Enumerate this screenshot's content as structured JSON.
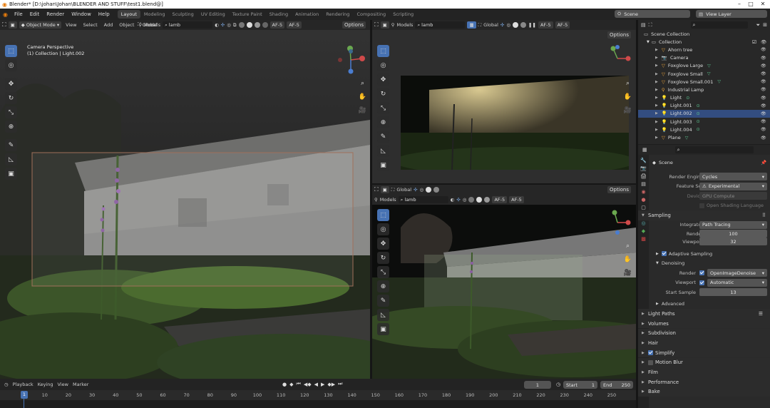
{
  "window": {
    "title": "Blender* [D:\\johan\\Johan\\BLENDER AND STUFF\\test1.blend@]"
  },
  "menu": [
    "File",
    "Edit",
    "Render",
    "Window",
    "Help"
  ],
  "workspaces": [
    "Layout",
    "Modeling",
    "Sculpting",
    "UV Editing",
    "Texture Paint",
    "Shading",
    "Animation",
    "Rendering",
    "Compositing",
    "Scripting"
  ],
  "active_workspace": "Layout",
  "top_right": {
    "scene": "Scene",
    "view_layer": "View Layer"
  },
  "viewport_main": {
    "mode": "Object Mode",
    "menus": [
      "View",
      "Select",
      "Add",
      "Object"
    ],
    "transform": "Global",
    "filter": "Models",
    "search": "lamb",
    "af": "AF-5",
    "options": "Options",
    "overlay_title": "Camera Perspective",
    "overlay_sub": "(1) Collection | Light.002"
  },
  "viewport_tr": {
    "transform": "Global",
    "filter": "Models",
    "search": "lamb",
    "af": "AF-5",
    "options": "Options"
  },
  "viewport_br": {
    "transform": "Global",
    "filter": "Models",
    "search": "lamb",
    "af": "AF-5",
    "options": "Options"
  },
  "outliner": {
    "root": "Scene Collection",
    "collection": "Collection",
    "items": [
      {
        "name": "Ahorn tree",
        "selected": false
      },
      {
        "name": "Camera",
        "selected": false
      },
      {
        "name": "Foxglove Large",
        "selected": false
      },
      {
        "name": "Foxglove Small",
        "selected": false
      },
      {
        "name": "Foxglove Small.001",
        "selected": false
      },
      {
        "name": "Industrial Lamp",
        "selected": false
      },
      {
        "name": "Light",
        "selected": false
      },
      {
        "name": "Light.001",
        "selected": false
      },
      {
        "name": "Light.002",
        "selected": true
      },
      {
        "name": "Light.003",
        "selected": false
      },
      {
        "name": "Light.004",
        "selected": false
      },
      {
        "name": "Plane",
        "selected": false
      }
    ]
  },
  "properties": {
    "context": "Scene",
    "render_engine_label": "Render Engine",
    "render_engine": "Cycles",
    "feature_set_label": "Feature Set",
    "feature_set": "Experimental",
    "device_label": "Device",
    "device": "GPU Compute",
    "osl": "Open Shading Language",
    "sampling": "Sampling",
    "integrator_label": "Integrator",
    "integrator": "Path Tracing",
    "render_label": "Render",
    "render_samples": "100",
    "viewport_label": "Viewport",
    "viewport_samples": "32",
    "adaptive": "Adaptive Sampling",
    "denoising": "Denoising",
    "dn_render_label": "Render",
    "dn_render": "OpenImageDenoise",
    "dn_viewport_label": "Viewport",
    "dn_viewport": "Automatic",
    "start_sample_label": "Start Sample",
    "start_sample": "13",
    "advanced": "Advanced",
    "panels": [
      "Light Paths",
      "Volumes",
      "Subdivision",
      "Hair",
      "Simplify",
      "Motion Blur",
      "Film",
      "Performance",
      "Bake"
    ]
  },
  "timeline": {
    "menus": [
      "Playback",
      "Keying",
      "View",
      "Marker"
    ],
    "current_frame": "1",
    "start_label": "Start",
    "start": "1",
    "end_label": "End",
    "end": "250",
    "ticks": [
      "1",
      "10",
      "20",
      "30",
      "40",
      "50",
      "60",
      "70",
      "80",
      "90",
      "100",
      "110",
      "120",
      "130",
      "140",
      "150",
      "160",
      "170",
      "180",
      "190",
      "200",
      "210",
      "220",
      "230",
      "240",
      "250"
    ]
  },
  "colors": {
    "accent": "#4772b3",
    "selection": "#334d80",
    "header": "#232323"
  }
}
